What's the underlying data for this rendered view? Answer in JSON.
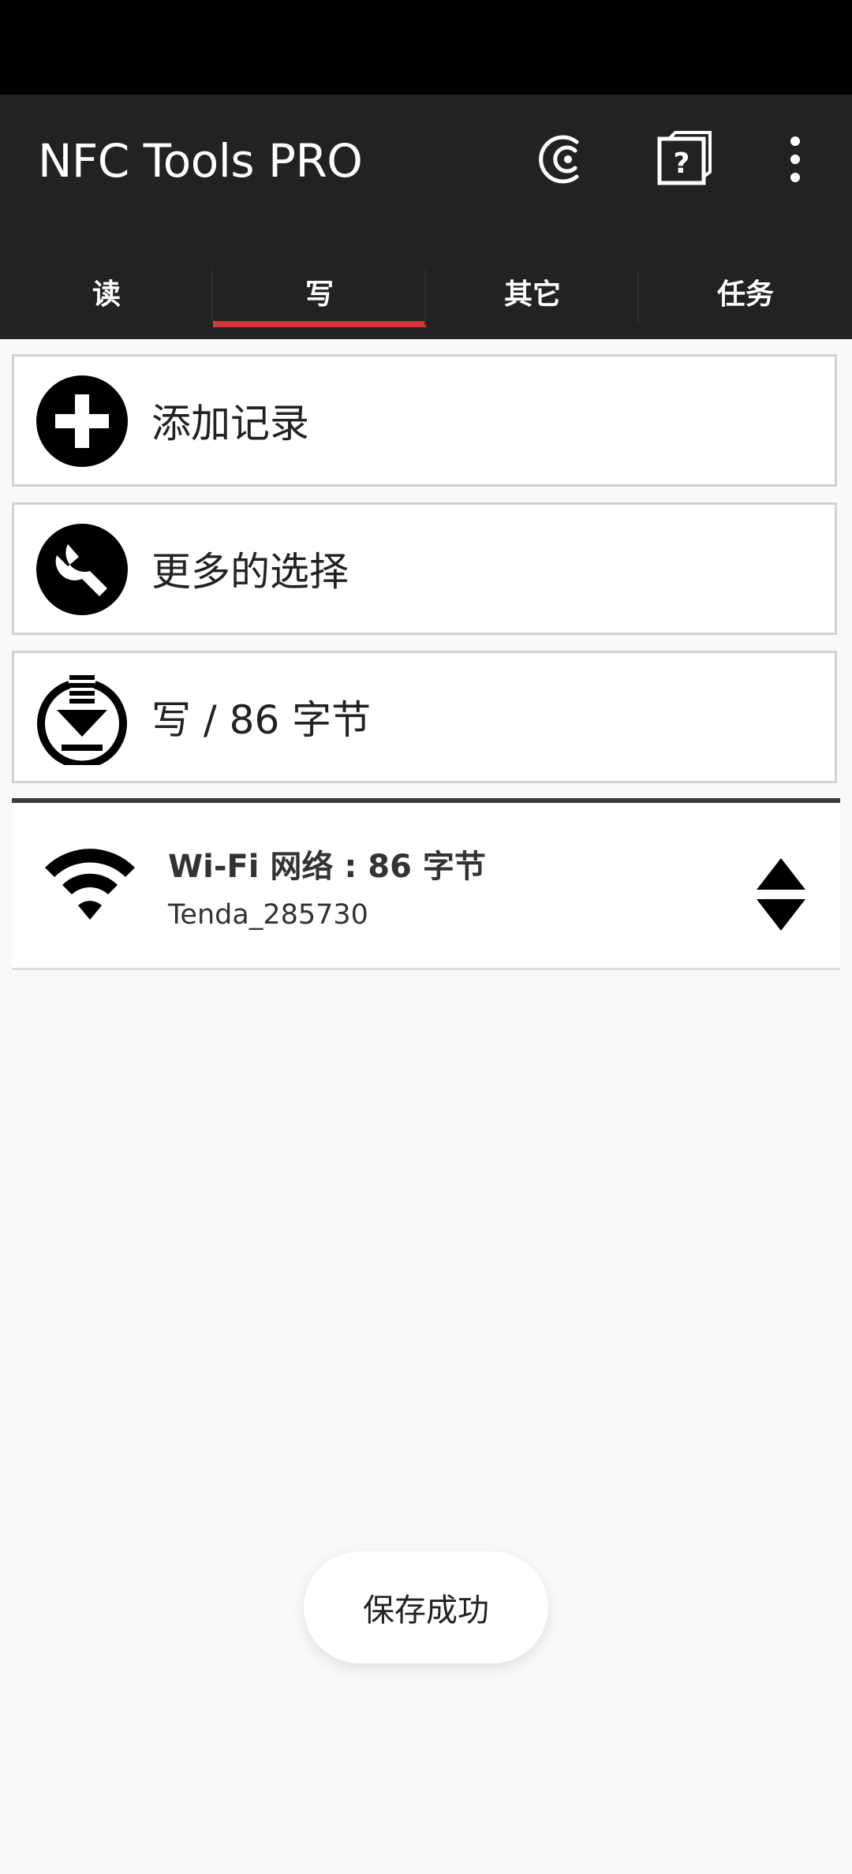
{
  "app_bar": {
    "title": "NFC Tools PRO",
    "actions": [
      {
        "icon": "nfc-c-icon"
      },
      {
        "icon": "help-icon",
        "glyph": "?"
      },
      {
        "icon": "more-vert-icon"
      }
    ]
  },
  "tabs": [
    {
      "label": "读",
      "active": false
    },
    {
      "label": "写",
      "active": true
    },
    {
      "label": "其它",
      "active": false
    },
    {
      "label": "任务",
      "active": false
    }
  ],
  "actions": [
    {
      "label": "添加记录",
      "icon": "add-circle-icon"
    },
    {
      "label": "更多的选择",
      "icon": "wrench-icon"
    },
    {
      "label": "写 / 86 字节",
      "icon": "write-download-icon"
    }
  ],
  "records": [
    {
      "icon": "wifi-icon",
      "title": "Wi-Fi 网络 : 86 字节",
      "subtitle": "Tenda_285730",
      "reorder_icon": "reorder-icon"
    }
  ],
  "toast": {
    "text": "保存成功"
  },
  "colors": {
    "status_bar": "#000000",
    "app_bar": "#222222",
    "tab_indicator": "#d3393b",
    "background": "#f9f9f9",
    "card_border": "#d2d2d2"
  }
}
